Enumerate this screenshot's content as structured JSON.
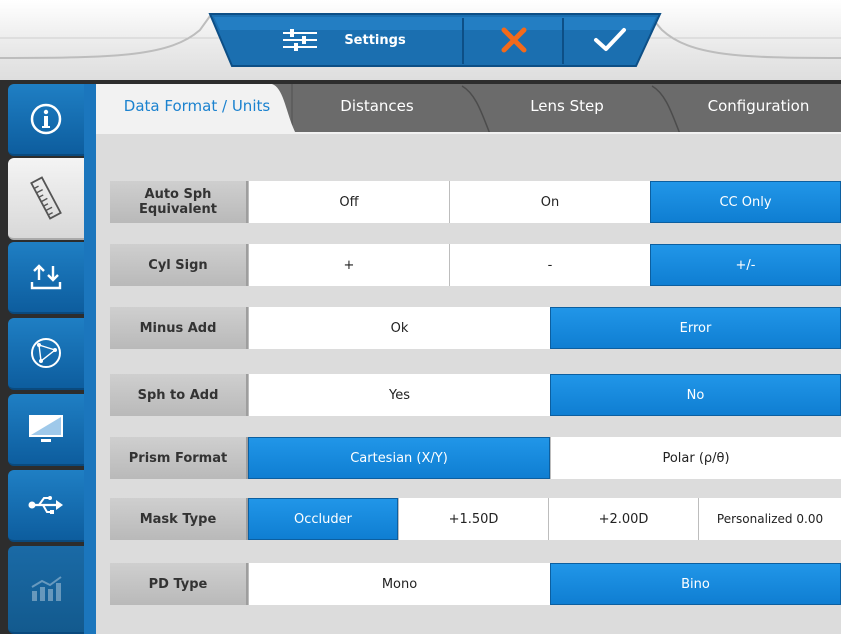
{
  "topbar": {
    "settings_label": "Settings",
    "icons": {
      "settings": "sliders-icon",
      "cancel": "close-icon",
      "confirm": "check-icon"
    }
  },
  "sidebar": {
    "items": [
      {
        "name": "info-icon",
        "state": "normal"
      },
      {
        "name": "ruler-icon",
        "state": "active"
      },
      {
        "name": "transfer-icon",
        "state": "normal"
      },
      {
        "name": "network-icon",
        "state": "normal"
      },
      {
        "name": "display-icon",
        "state": "normal"
      },
      {
        "name": "usb-icon",
        "state": "normal"
      },
      {
        "name": "chart-icon",
        "state": "disabled"
      }
    ]
  },
  "tabs": [
    {
      "label": "Data Format / Units",
      "active": true
    },
    {
      "label": "Distances",
      "active": false
    },
    {
      "label": "Lens Step",
      "active": false
    },
    {
      "label": "Configuration",
      "active": false
    }
  ],
  "rows": [
    {
      "label": "Auto Sph\nEquivalent",
      "options": [
        "Off",
        "On",
        "CC Only"
      ],
      "selected": 2
    },
    {
      "label": "Cyl Sign",
      "options": [
        "+",
        "-",
        "+/-"
      ],
      "selected": 2
    },
    {
      "label": "Minus Add",
      "options": [
        "Ok",
        "Error"
      ],
      "selected": 1
    },
    {
      "label": "Sph to Add",
      "options": [
        "Yes",
        "No"
      ],
      "selected": 1
    },
    {
      "label": "Prism Format",
      "options": [
        "Cartesian (X/Y)",
        "Polar (ρ/θ)"
      ],
      "selected": 0
    },
    {
      "label": "Mask Type",
      "options": [
        "Occluder",
        "+1.50D",
        "+2.00D",
        "Personalized 0.00"
      ],
      "selected": 0
    },
    {
      "label": "PD Type",
      "options": [
        "Mono",
        "Bino"
      ],
      "selected": 1
    }
  ],
  "colors": {
    "accent": "#1b82cf",
    "selected": "#1485d8",
    "frame": "#2d2d2d",
    "cancel": "#f26a1b"
  }
}
